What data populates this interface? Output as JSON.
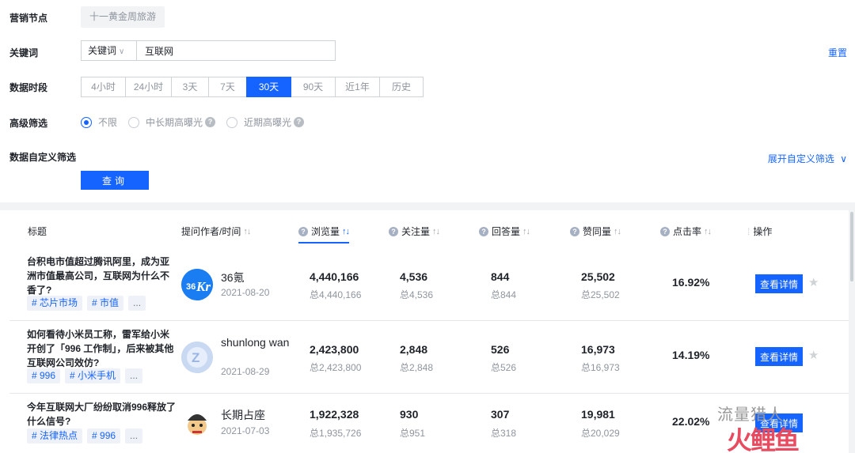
{
  "filters": {
    "node_label": "营销节点",
    "node_value": "十一黄金周旅游",
    "keyword_label": "关键词",
    "keyword_type": "关键词",
    "keyword_value": "互联网",
    "reset": "重置",
    "period_label": "数据时段",
    "periods": [
      "4小时",
      "24小时",
      "3天",
      "7天",
      "30天",
      "90天",
      "近1年",
      "历史"
    ],
    "period_active": "30天",
    "advanced_label": "高级筛选",
    "advanced_options": [
      "不限",
      "中长期高曝光",
      "近期高曝光"
    ],
    "advanced_selected": "不限",
    "custom_label": "数据自定义筛选",
    "expand": "展开自定义筛选",
    "query": "查询"
  },
  "table": {
    "headers": {
      "title": "标题",
      "author": "提问作者/时间",
      "views": "浏览量",
      "follows": "关注量",
      "answers": "回答量",
      "likes": "赞同量",
      "ctr": "点击率",
      "actions": "操作"
    },
    "rows": [
      {
        "title": "台积电市值超过腾讯阿里，成为亚洲市值最高公司，互联网为什么不香了?",
        "tags": [
          "# 芯片市场",
          "# 市值",
          "..."
        ],
        "author": "36氪",
        "date": "2021-08-20",
        "views": "4,440,166",
        "views_total": "总4,440,166",
        "follows": "4,536",
        "follows_total": "总4,536",
        "answers": "844",
        "answers_total": "总844",
        "likes": "25,502",
        "likes_total": "总25,502",
        "ctr": "16.92%",
        "detail": "查看详情"
      },
      {
        "title": "如何看待小米员工称，雷军给小米开创了「996 工作制」，后来被其他互联网公司效仿?",
        "tags": [
          "# 996",
          "# 小米手机",
          "..."
        ],
        "author": "shunlong wan",
        "date": "2021-08-29",
        "views": "2,423,800",
        "views_total": "总2,423,800",
        "follows": "2,848",
        "follows_total": "总2,848",
        "answers": "526",
        "answers_total": "总526",
        "likes": "16,973",
        "likes_total": "总16,973",
        "ctr": "14.19%",
        "detail": "查看详情"
      },
      {
        "title": "今年互联网大厂纷纷取消996释放了什么信号?",
        "tags": [
          "# 法律热点",
          "# 996",
          "..."
        ],
        "author": "长期占座",
        "date": "2021-07-03",
        "views": "1,922,328",
        "views_total": "总1,935,726",
        "follows": "930",
        "follows_total": "总951",
        "answers": "307",
        "answers_total": "总318",
        "likes": "19,981",
        "likes_total": "总20,029",
        "ctr": "22.02%",
        "detail": "查看详情"
      }
    ]
  },
  "watermark": {
    "line1": "流量猎人",
    "line2": "火鲤鱼"
  }
}
